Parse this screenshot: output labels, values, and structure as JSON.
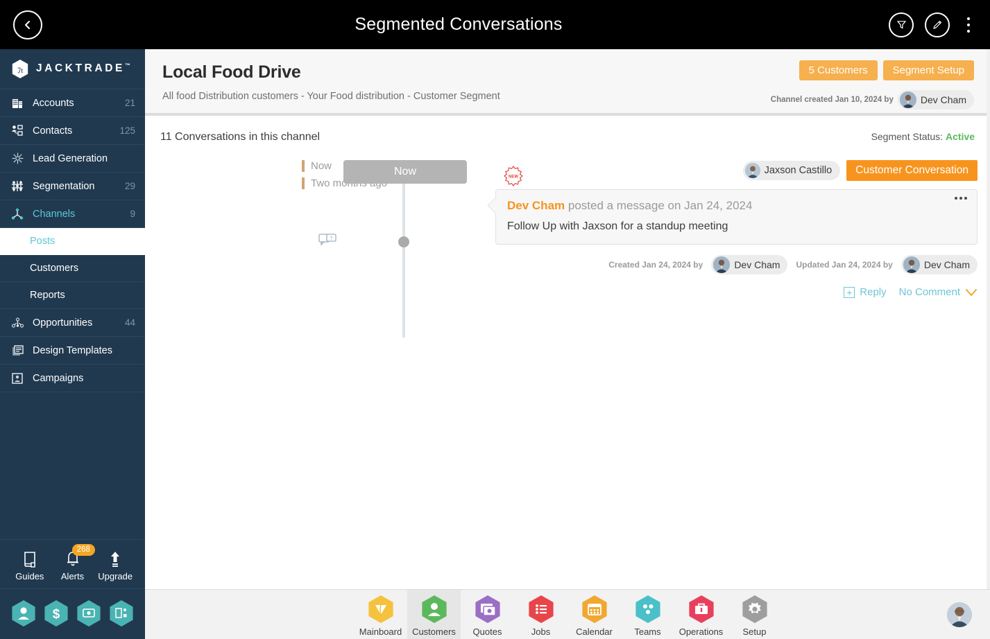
{
  "topbar": {
    "title": "Segmented Conversations",
    "back_icon": "chevron-left-icon",
    "filter_icon": "funnel-icon",
    "edit_icon": "pencil-icon",
    "more_icon": "kebab-menu-icon"
  },
  "sidebar": {
    "brand": "JACKTRADE",
    "brand_tm": "™",
    "items": [
      {
        "label": "Accounts",
        "count": "21",
        "icon": "building-icon"
      },
      {
        "label": "Contacts",
        "count": "125",
        "icon": "contacts-icon"
      },
      {
        "label": "Lead Generation",
        "count": "",
        "icon": "lead-gen-icon"
      },
      {
        "label": "Segmentation",
        "count": "29",
        "icon": "segmentation-icon"
      },
      {
        "label": "Channels",
        "count": "9",
        "icon": "channels-icon"
      }
    ],
    "sub_items": [
      {
        "label": "Posts"
      },
      {
        "label": "Customers"
      },
      {
        "label": "Reports"
      }
    ],
    "items_after": [
      {
        "label": "Opportunities",
        "count": "44",
        "icon": "opportunities-icon"
      },
      {
        "label": "Design Templates",
        "count": "",
        "icon": "design-templates-icon"
      },
      {
        "label": "Campaigns",
        "count": "",
        "icon": "campaigns-icon"
      }
    ],
    "utils": [
      {
        "label": "Guides",
        "icon": "book-icon",
        "badge": ""
      },
      {
        "label": "Alerts",
        "icon": "bell-icon",
        "badge": "268"
      },
      {
        "label": "Upgrade",
        "icon": "up-arrow-icon",
        "badge": ""
      }
    ],
    "hex_buttons": [
      {
        "icon": "person-hex-icon"
      },
      {
        "icon": "dollar-hex-icon"
      },
      {
        "icon": "money-hex-icon"
      },
      {
        "icon": "workflow-hex-icon"
      }
    ]
  },
  "content_header": {
    "title": "Local Food Drive",
    "subtitle": "All food Distribution customers - Your Food distribution - Customer Segment",
    "customers_button": "5 Customers",
    "segment_setup_button": "Segment Setup",
    "created_text": "Channel created Jan 10, 2024 by",
    "created_by": "Dev Cham"
  },
  "conversations": {
    "count_text": "11 Conversations in this channel",
    "segment_status_label": "Segment Status:",
    "segment_status_value": "Active"
  },
  "timeline": {
    "legend": [
      {
        "label": "Now"
      },
      {
        "label": "Two months ago"
      }
    ],
    "now_chip": "Now"
  },
  "message": {
    "new_badge": "NEW",
    "tag_name": "Jaxson Castillo",
    "tag_type": "Customer Conversation",
    "author": "Dev Cham",
    "headline_rest": " posted a message on Jan 24, 2024",
    "body": "Follow Up with Jaxson for a standup meeting",
    "created_text": "Created Jan 24, 2024 by",
    "created_by": "Dev Cham",
    "updated_text": "Updated Jan 24, 2024 by",
    "updated_by": "Dev Cham",
    "reply_label": "Reply",
    "comment_label": "No Comment",
    "more_icon": "kebab-menu-icon"
  },
  "bottombar": {
    "items": [
      {
        "label": "Mainboard",
        "color": "#f5c23e",
        "icon": "mainboard-icon"
      },
      {
        "label": "Customers",
        "color": "#5cb85c",
        "icon": "customers-icon"
      },
      {
        "label": "Quotes",
        "color": "#9b6fc4",
        "icon": "quotes-icon"
      },
      {
        "label": "Jobs",
        "color": "#e8454a",
        "icon": "jobs-icon"
      },
      {
        "label": "Calendar",
        "color": "#f0a830",
        "icon": "calendar-icon"
      },
      {
        "label": "Teams",
        "color": "#4bc0c8",
        "icon": "teams-icon"
      },
      {
        "label": "Operations",
        "color": "#e8405c",
        "icon": "operations-icon"
      },
      {
        "label": "Setup",
        "color": "#9e9e9e",
        "icon": "setup-gear-icon"
      }
    ],
    "active": "Customers",
    "avatar": "user-avatar"
  },
  "colors": {
    "sidebar_bg": "#20394f",
    "topbar_bg": "#000000",
    "accent_orange": "#f7941e",
    "accent_amber": "#f6b04e",
    "accent_teal": "#5bc8d6",
    "status_green": "#5cb85c"
  }
}
